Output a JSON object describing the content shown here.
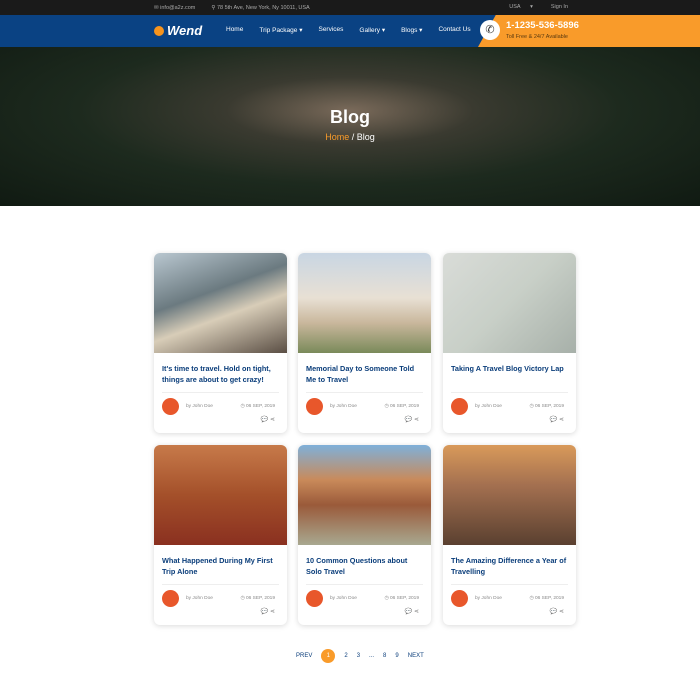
{
  "topbar": {
    "email": "info@a2z.com",
    "address": "78 5th Ave, New York, Ny 10011, USA",
    "language": "USA",
    "signin": "Sign In"
  },
  "nav": {
    "logo": "Wend",
    "items": [
      "Home",
      "Trip Package",
      "Services",
      "Gallery",
      "Blogs",
      "Contact Us"
    ],
    "dropdowns": [
      false,
      true,
      false,
      true,
      true,
      false
    ],
    "phone": "1-1235-536-5896",
    "phone_sub": "Toll Free & 24/7 Available"
  },
  "hero": {
    "title": "Blog",
    "crumb_home": "Home",
    "crumb_sep": " / ",
    "crumb_current": "Blog"
  },
  "posts": [
    {
      "title": "It's time to travel. Hold on tight, things are about to get crazy!",
      "author": "by John Doe",
      "date": "06 SEP, 2019"
    },
    {
      "title": "Memorial Day to Someone Told Me to Travel",
      "author": "by John Doe",
      "date": "06 SEP, 2019"
    },
    {
      "title": "Taking A Travel Blog Victory Lap",
      "author": "by John Doe",
      "date": "06 SEP, 2019"
    },
    {
      "title": "What Happened During My First Trip Alone",
      "author": "by John Doe",
      "date": "06 SEP, 2019"
    },
    {
      "title": "10 Common Questions about Solo Travel",
      "author": "by John Doe",
      "date": "06 SEP, 2019"
    },
    {
      "title": "The Amazing Difference a Year of Travelling",
      "author": "by John Doe",
      "date": "06 SEP, 2019"
    }
  ],
  "pagination": {
    "prev": "PREV",
    "pages": [
      "1",
      "2",
      "3",
      "...",
      "8",
      "9"
    ],
    "current": "1",
    "next": "NEXT"
  },
  "colors": {
    "primary": "#0a4283",
    "accent": "#f99b2a"
  }
}
